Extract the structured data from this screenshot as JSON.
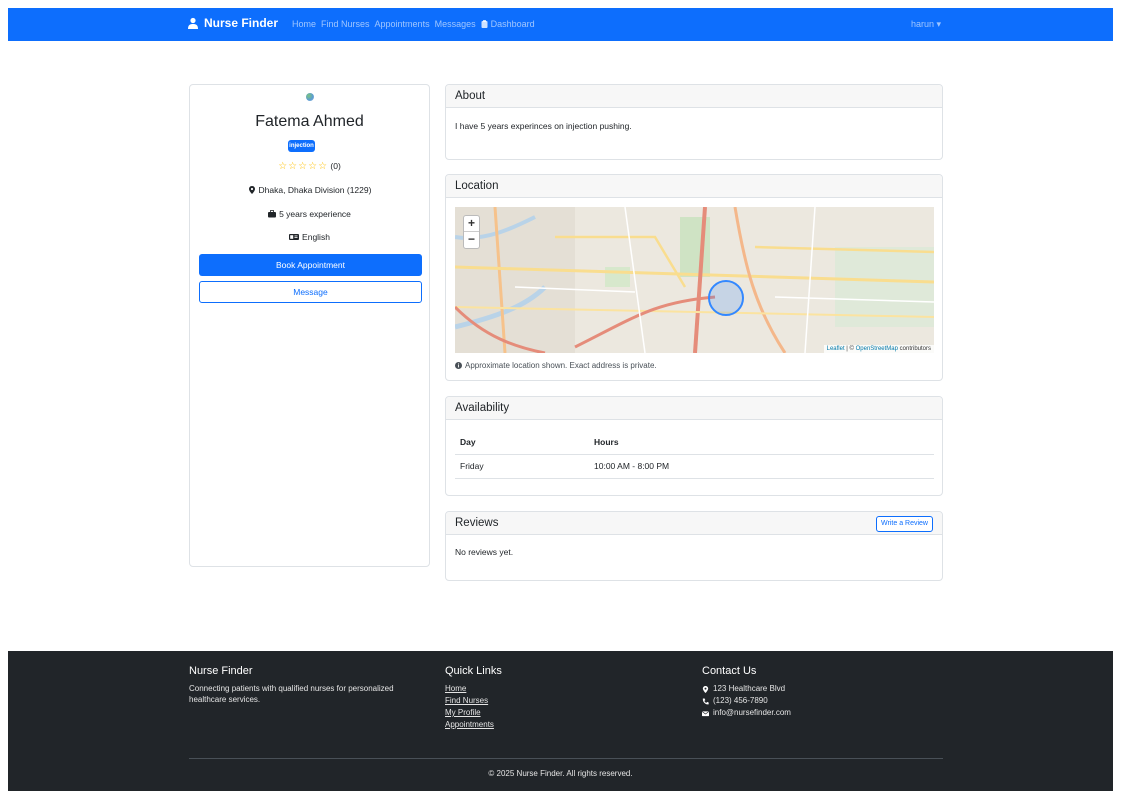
{
  "navbar": {
    "brand": "Nurse Finder",
    "links": [
      "Home",
      "Find Nurses",
      "Appointments",
      "Messages"
    ],
    "dashboard": "Dashboard",
    "user": "harun ▾",
    "bg_color": "#0d6efd"
  },
  "profile": {
    "name": "Fatema Ahmed",
    "specialty": "injection",
    "stars": "☆☆☆☆☆",
    "rating_count": "(0)",
    "location": "Dhaka, Dhaka Division (1229)",
    "experience": "5 years experience",
    "language": "English",
    "book_button": "Book Appointment",
    "message_button": "Message"
  },
  "about": {
    "title": "About",
    "text": "I have 5 years experinces on injection pushing."
  },
  "location": {
    "title": "Location",
    "zoom_in": "+",
    "zoom_out": "−",
    "attribution_leaflet": "Leaflet",
    "attribution_sep": " | © ",
    "attribution_osm": "OpenStreetMap",
    "attribution_tail": " contributors",
    "note": "Approximate location shown. Exact address is private."
  },
  "availability": {
    "title": "Availability",
    "headers": [
      "Day",
      "Hours"
    ],
    "rows": [
      {
        "day": "Friday",
        "hours": "10:00 AM - 8:00 PM"
      }
    ]
  },
  "reviews": {
    "title": "Reviews",
    "write_button": "Write a Review",
    "empty_text": "No reviews yet."
  },
  "footer": {
    "brand_title": "Nurse Finder",
    "brand_text": "Connecting patients with qualified nurses for personalized healthcare services.",
    "links_title": "Quick Links",
    "links": [
      "Home",
      "Find Nurses",
      "My Profile",
      "Appointments"
    ],
    "contact_title": "Contact Us",
    "address": "123 Healthcare Blvd",
    "phone": "(123) 456-7890",
    "email": "info@nursefinder.com",
    "copyright": "© 2025 Nurse Finder. All rights reserved."
  }
}
